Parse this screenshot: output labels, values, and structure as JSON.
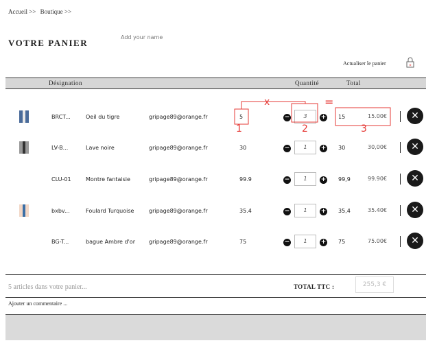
{
  "breadcrumb": {
    "home": "Accueil >>",
    "shop": "Boutique >>"
  },
  "title": "VOTRE PANIER",
  "name_placeholder": "Add your name",
  "refresh_label": "Actualiser le panier",
  "columns": {
    "designation": "Désignation",
    "quantite": "Quantité",
    "total": "Total"
  },
  "rows": [
    {
      "ref": "BRCT...",
      "name": "Oeil du tigre",
      "email": "gripage89@orange.fr",
      "price": "5",
      "qty": "3",
      "subtotal": "15",
      "total": "15.00€"
    },
    {
      "ref": "LV-B...",
      "name": "Lave noire",
      "email": "gripage89@orange.fr",
      "price": "30",
      "qty": "1",
      "subtotal": "30",
      "total": "30,00€"
    },
    {
      "ref": "CLU-01",
      "name": "Montre fantaisie",
      "email": "gripage89@orange.fr",
      "price": "99.9",
      "qty": "1",
      "subtotal": "99,9",
      "total": "99.90€"
    },
    {
      "ref": "bxbv...",
      "name": "Foulard Turquoise",
      "email": "gripage89@orange.fr",
      "price": "35.4",
      "qty": "1",
      "subtotal": "35,4",
      "total": "35.40€"
    },
    {
      "ref": "BG-T...",
      "name": "bague Ambre d'or",
      "email": "gripage89@orange.fr",
      "price": "75",
      "qty": "1",
      "subtotal": "75",
      "total": "75.00€"
    }
  ],
  "annotations": {
    "times": "x",
    "equals": "=",
    "n1": "1",
    "n2": "2",
    "n3": "3"
  },
  "footer": {
    "count": "5 articles dans votre panier...",
    "total_label": "TOTAL TTC :",
    "total_value": "255,3 €",
    "comment": "Ajouter un commentaire ..."
  },
  "colors": {
    "annotation": "#e53935",
    "header_bg": "#d6d6d6"
  }
}
